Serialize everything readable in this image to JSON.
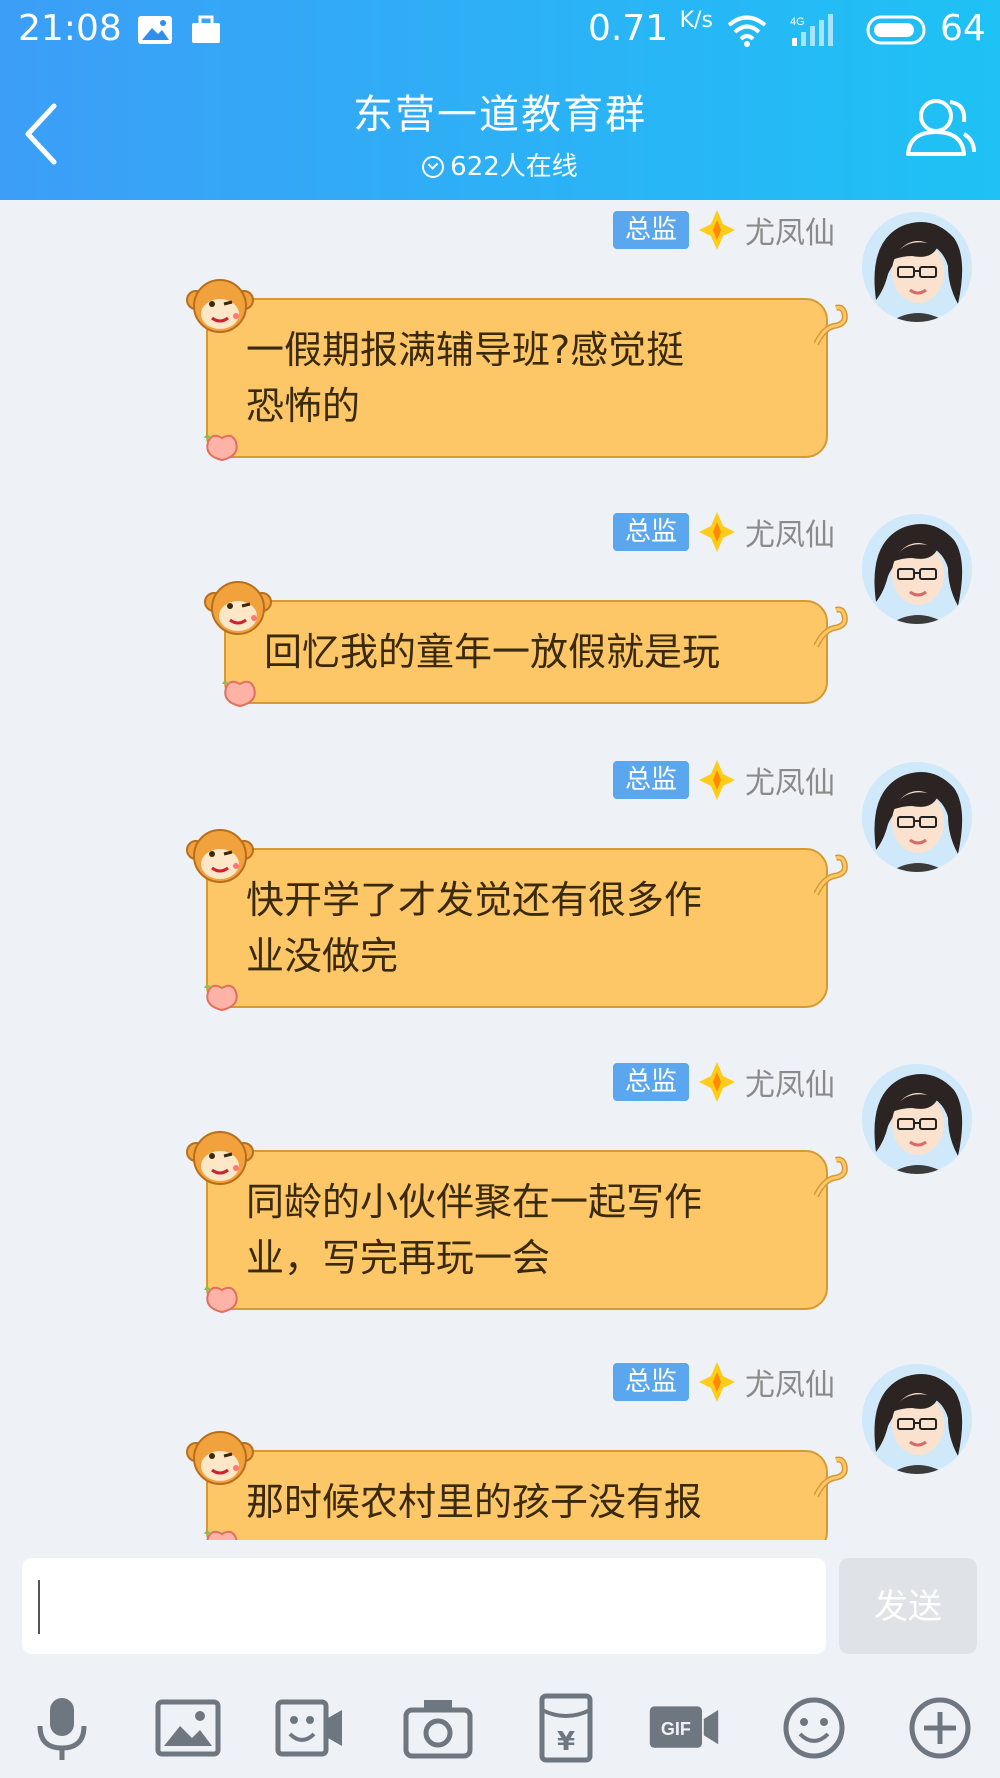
{
  "status_bar": {
    "time": "21:08",
    "speed": "0.71",
    "speed_unit": "K/s",
    "network": "4G",
    "battery": "64"
  },
  "header": {
    "title": "东营一道教育群",
    "online": "622人在线"
  },
  "messages": [
    {
      "badge": "总监",
      "sender": "尤凤仙",
      "lines": [
        "一假期报满辅导班?感觉挺",
        "恐怖的"
      ]
    },
    {
      "badge": "总监",
      "sender": "尤凤仙",
      "lines": [
        "回忆我的童年一放假就是玩"
      ]
    },
    {
      "badge": "总监",
      "sender": "尤凤仙",
      "lines": [
        "快开学了才发觉还有很多作",
        "业没做完"
      ]
    },
    {
      "badge": "总监",
      "sender": "尤凤仙",
      "lines": [
        "同龄的小伙伴聚在一起写作",
        "业，写完再玩一会"
      ]
    },
    {
      "badge": "总监",
      "sender": "尤凤仙",
      "lines": [
        "那时候农村里的孩子没有报"
      ]
    }
  ],
  "input": {
    "value": "",
    "send_label": "发送"
  },
  "toolbar": {
    "icons": [
      "microphone-icon",
      "image-icon",
      "video-call-icon",
      "camera-icon",
      "red-packet-icon",
      "gif-icon",
      "emoji-icon",
      "plus-icon"
    ],
    "gif_label": "GIF"
  },
  "colors": {
    "header_start": "#3c9ef7",
    "header_end": "#1ec2f5",
    "bubble": "#fdc768",
    "badge": "#5aa7f0"
  }
}
